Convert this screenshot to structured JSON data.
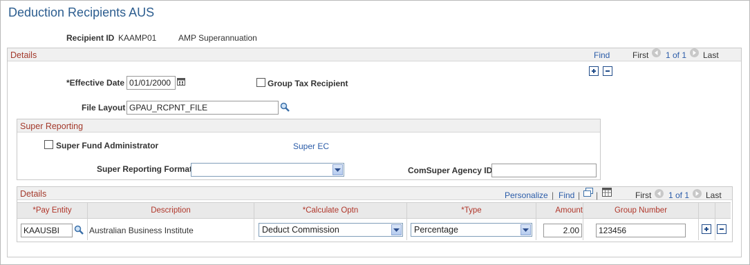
{
  "page": {
    "title": "Deduction Recipients AUS"
  },
  "recipient": {
    "id_label": "Recipient ID",
    "id_value": "KAAMP01",
    "name": "AMP Superannuation"
  },
  "details": {
    "label": "Details",
    "find": "Find",
    "first": "First",
    "range": "1 of 1",
    "last": "Last",
    "effective_date_label": "*Effective Date",
    "effective_date_value": "01/01/2000",
    "group_tax_label": "Group Tax Recipient",
    "group_tax_checked": false,
    "file_layout_label": "File Layout",
    "file_layout_value": "GPAU_RCPNT_FILE"
  },
  "super_reporting": {
    "label": "Super Reporting",
    "super_fund_admin_label": "Super Fund Administrator",
    "super_fund_admin_checked": false,
    "super_ec_link": "Super EC",
    "format_label": "Super Reporting Format",
    "format_value": "",
    "comsuper_label": "ComSuper Agency ID",
    "comsuper_value": ""
  },
  "grid": {
    "label": "Details",
    "personalize": "Personalize",
    "find": "Find",
    "first": "First",
    "range": "1 of 1",
    "last": "Last",
    "columns": [
      "*Pay Entity",
      "Description",
      "*Calculate Optn",
      "*Type",
      "Amount",
      "Group Number"
    ],
    "rows": [
      {
        "pay_entity": "KAAUSBI",
        "description": "Australian Business Institute",
        "calculate_optn": "Deduct Commission",
        "type": "Percentage",
        "amount": "2.00",
        "group_number": "123456"
      }
    ]
  },
  "icons": [
    "calendar-icon",
    "lookup-icon",
    "prompt-icon",
    "add-row-icon",
    "delete-row-icon",
    "first-arrow-icon",
    "last-arrow-icon",
    "view-all-icon",
    "download-icon"
  ]
}
